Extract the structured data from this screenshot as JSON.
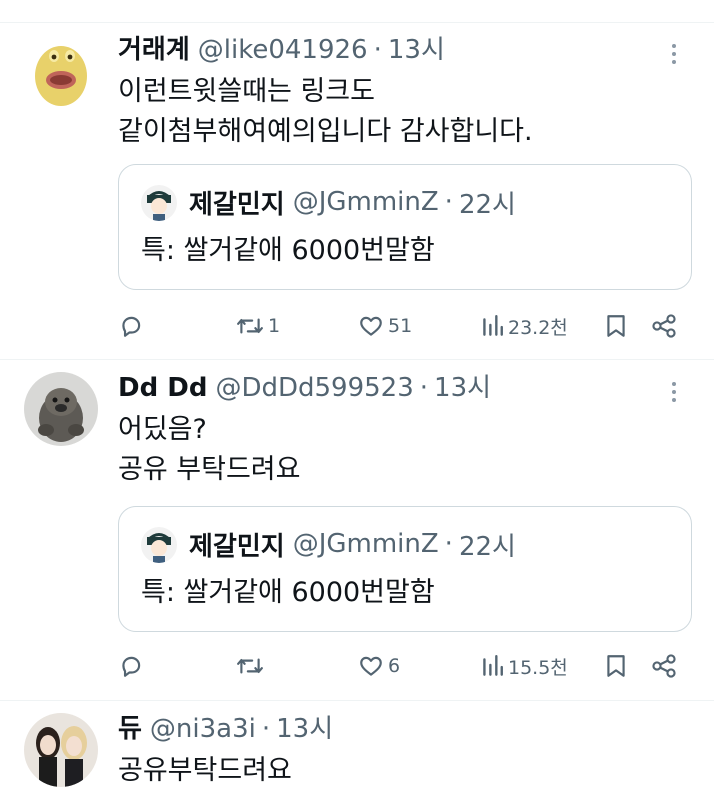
{
  "tweets": [
    {
      "name": "거래계",
      "handle": "@like041926",
      "dot": "·",
      "time": "13시",
      "lines": [
        "이런트윗쓸때는 링크도",
        "같이첨부해여예의입니다 감사합니다."
      ],
      "quote": {
        "name": "제갈민지",
        "handle": "@JGmminZ",
        "dot": "·",
        "time": "22시",
        "text": "특: 쌀거같애 6000번말함"
      },
      "actions": {
        "reply_count": "",
        "retweet_count": "1",
        "like_count": "51",
        "views_count": "23.2천"
      }
    },
    {
      "name": "Dd Dd",
      "handle": "@DdDd599523",
      "dot": "·",
      "time": "13시",
      "lines": [
        "어딨음?",
        "공유 부탁드려요"
      ],
      "quote": {
        "name": "제갈민지",
        "handle": "@JGmminZ",
        "dot": "·",
        "time": "22시",
        "text": "특: 쌀거같애 6000번말함"
      },
      "actions": {
        "reply_count": "",
        "retweet_count": "",
        "like_count": "6",
        "views_count": "15.5천"
      }
    },
    {
      "name": "듀",
      "handle": "@ni3a3i",
      "dot": "·",
      "time": "13시",
      "lines": [
        "공유부탁드려요"
      ]
    }
  ],
  "icons": {
    "more": "more-vertical-icon",
    "reply": "reply-icon",
    "retweet": "retweet-icon",
    "like": "heart-icon",
    "views": "views-bar-chart-icon",
    "bookmark": "bookmark-icon",
    "share": "share-icon"
  },
  "colors": {
    "text_primary": "#0f1419",
    "text_secondary": "#536471",
    "border": "#cfd9de",
    "divider": "#eff3f4"
  }
}
